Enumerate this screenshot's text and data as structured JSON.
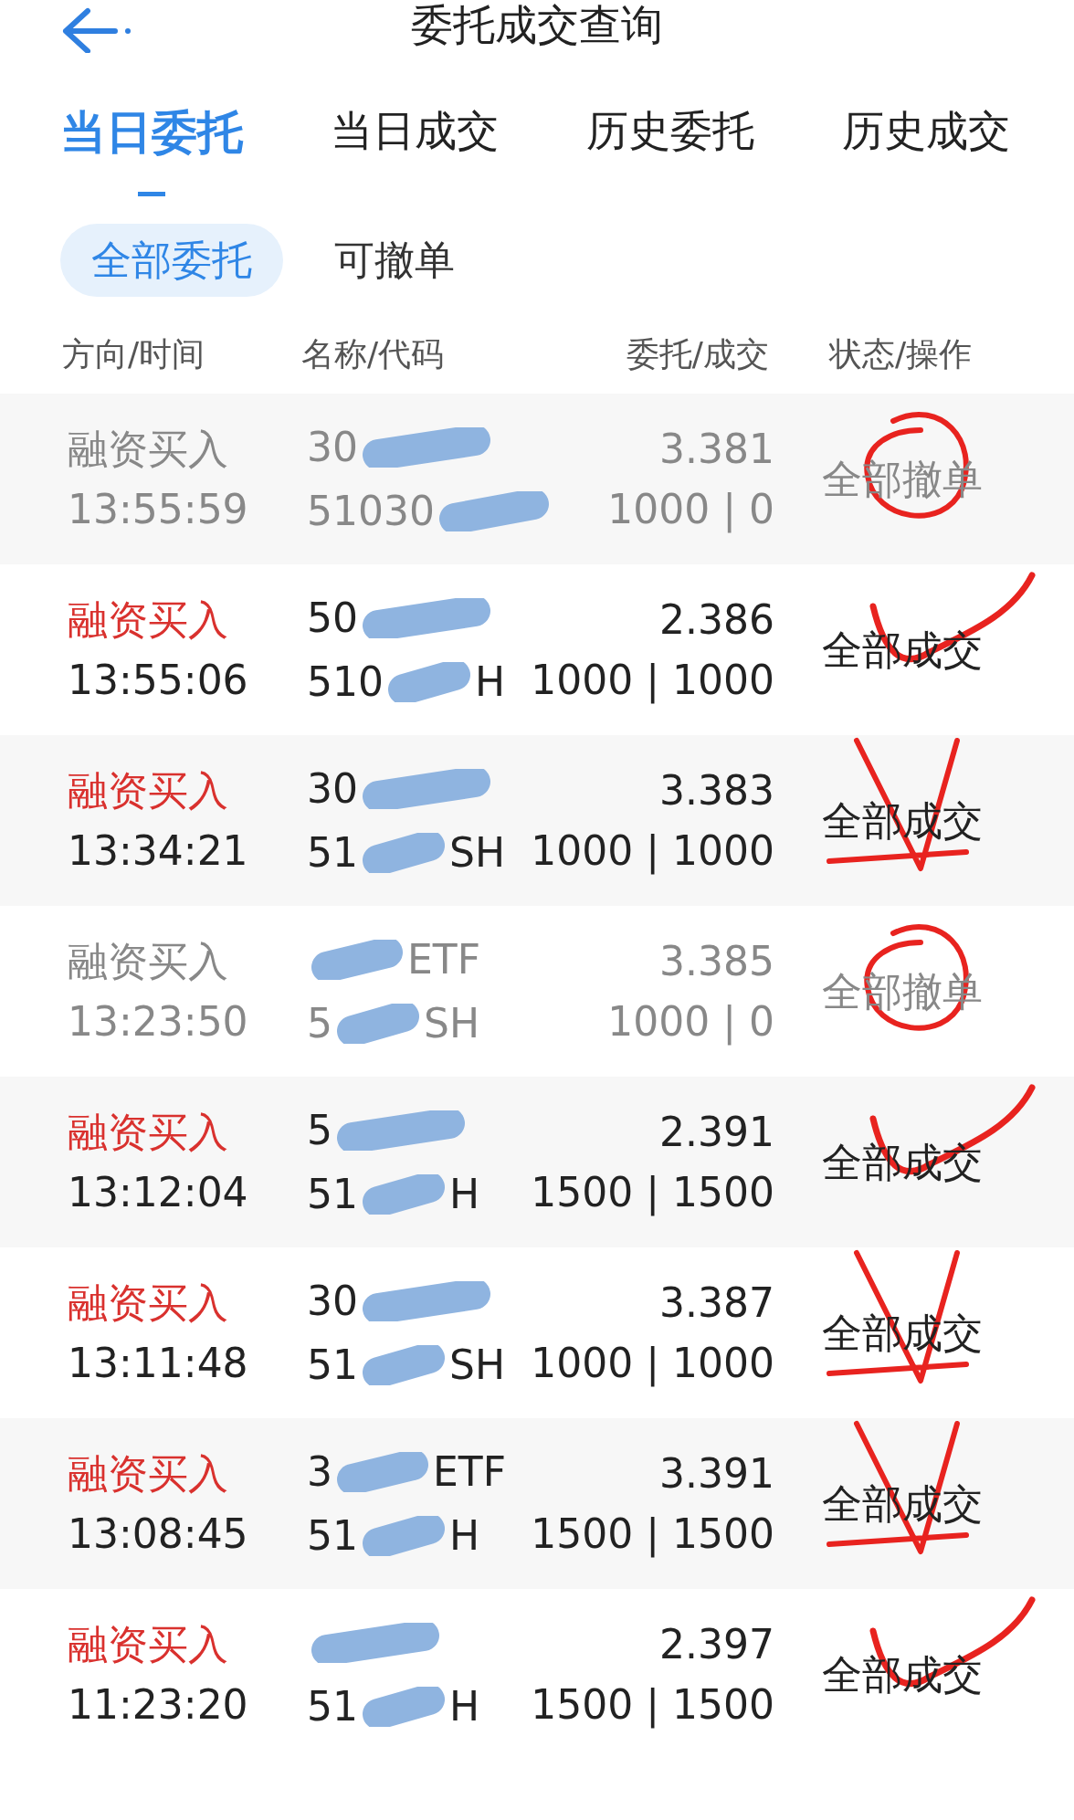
{
  "header": {
    "title": "委托成交查询"
  },
  "tabs": [
    {
      "label": "当日委托",
      "selected": true
    },
    {
      "label": "当日成交",
      "selected": false
    },
    {
      "label": "历史委托",
      "selected": false
    },
    {
      "label": "历史成交",
      "selected": false
    }
  ],
  "filters": [
    {
      "label": "全部委托",
      "selected": true
    },
    {
      "label": "可撤单",
      "selected": false
    }
  ],
  "columns": [
    "方向/时间",
    "名称/代码",
    "委托/成交",
    "状态/操作"
  ],
  "rows": [
    {
      "direction": "融资买入",
      "time": "13:55:59",
      "name": "30",
      "name_tail": "",
      "code": "51030",
      "code_tail": "",
      "price": "3.381",
      "qty": "1000 | 0",
      "status": "全部撤单",
      "filled": false,
      "annotation": {
        "kind": "circle"
      }
    },
    {
      "direction": "融资买入",
      "time": "13:55:06",
      "name": "50",
      "name_tail": "",
      "code": "510",
      "code_tail": "H",
      "price": "2.386",
      "qty": "1000 | 1000",
      "status": "全部成交",
      "filled": true,
      "annotation": {
        "kind": "check"
      }
    },
    {
      "direction": "融资买入",
      "time": "13:34:21",
      "name": "30",
      "name_tail": "",
      "code": "51",
      "code_tail": "SH",
      "price": "3.383",
      "qty": "1000 | 1000",
      "status": "全部成交",
      "filled": true,
      "annotation": {
        "kind": "star"
      }
    },
    {
      "direction": "融资买入",
      "time": "13:23:50",
      "name": "",
      "name_tail": "ETF",
      "code": "5",
      "code_tail": "SH",
      "price": "3.385",
      "qty": "1000 | 0",
      "status": "全部撤单",
      "filled": false,
      "annotation": {
        "kind": "circle"
      }
    },
    {
      "direction": "融资买入",
      "time": "13:12:04",
      "name": "5",
      "name_tail": "",
      "code": "51",
      "code_tail": "H",
      "price": "2.391",
      "qty": "1500 | 1500",
      "status": "全部成交",
      "filled": true,
      "annotation": {
        "kind": "check"
      }
    },
    {
      "direction": "融资买入",
      "time": "13:11:48",
      "name": "30",
      "name_tail": "",
      "code": "51",
      "code_tail": "SH",
      "price": "3.387",
      "qty": "1000 | 1000",
      "status": "全部成交",
      "filled": true,
      "annotation": {
        "kind": "star"
      }
    },
    {
      "direction": "融资买入",
      "time": "13:08:45",
      "name": "3",
      "name_tail": "ETF",
      "code": "51",
      "code_tail": "H",
      "price": "3.391",
      "qty": "1500 | 1500",
      "status": "全部成交",
      "filled": true,
      "annotation": {
        "kind": "star"
      }
    },
    {
      "direction": "融资买入",
      "time": "11:23:20",
      "name": "",
      "name_tail": "",
      "code": "51",
      "code_tail": "H",
      "price": "2.397",
      "qty": "1500 | 1500",
      "status": "全部成交",
      "filled": true,
      "annotation": {
        "kind": "check"
      }
    }
  ]
}
